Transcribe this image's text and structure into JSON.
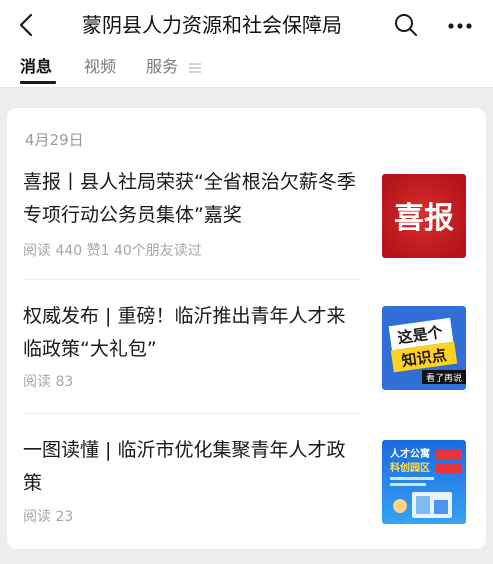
{
  "header": {
    "title": "蒙阴县人力资源和社会保障局"
  },
  "tabs": [
    {
      "label": "消息"
    },
    {
      "label": "视频"
    },
    {
      "label": "服务"
    }
  ],
  "feed": {
    "date": "4月29日",
    "articles": [
      {
        "title": "喜报丨县人社局荣获“全省根治欠薪冬季专项行动公务员集体”嘉奖",
        "meta": "阅读 440  赞1  40个朋友读过",
        "thumb_text": "喜报",
        "thumb_color": "#c8161d"
      },
      {
        "title": "权威发布 | 重磅！临沂推出青年人才来临政策“大礼包”",
        "meta": "阅读 83",
        "thumb_text": "这是个",
        "thumb_text2": "知识点",
        "thumb_text3": "看了再说",
        "thumb_color": "#2f6fd6"
      },
      {
        "title": "一图读懂 | 临沂市优化集聚青年人才政策",
        "meta": "阅读 23",
        "thumb_text": "人才公寓",
        "thumb_text2": "科创园区",
        "thumb_color": "#1f78e6"
      }
    ]
  }
}
